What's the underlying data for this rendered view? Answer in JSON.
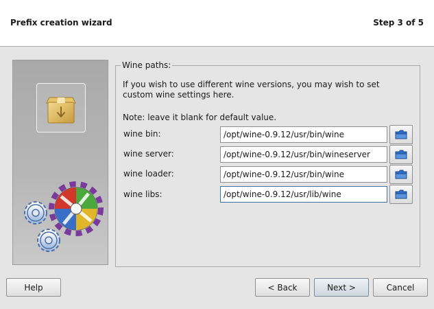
{
  "header": {
    "title": "Prefix creation wizard",
    "step": "Step 3 of 5"
  },
  "group": {
    "legend": "Wine paths:",
    "intro": "If you wish to use different wine versions, you may wish to set custom wine settings here.",
    "note": "Note: leave it blank for default value."
  },
  "fields": [
    {
      "label": "wine bin:",
      "value": "/opt/wine-0.9.12/usr/bin/wine"
    },
    {
      "label": "wine server:",
      "value": "/opt/wine-0.9.12/usr/bin/wineserver"
    },
    {
      "label": "wine loader:",
      "value": "/opt/wine-0.9.12/usr/bin/wine"
    },
    {
      "label": "wine libs:",
      "value": "/opt/wine-0.9.12/usr/lib/wine"
    }
  ],
  "icons": {
    "sidebar_package": "package-icon",
    "sidebar_gears": "gears-icon",
    "browse": "folder-icon"
  },
  "buttons": {
    "help": "Help",
    "back": "< Back",
    "next": "Next >",
    "cancel": "Cancel"
  },
  "colors": {
    "header_bg": "#ffffff",
    "window_bg": "#e5e5e5",
    "folder_blue": "#2f6fc9"
  }
}
